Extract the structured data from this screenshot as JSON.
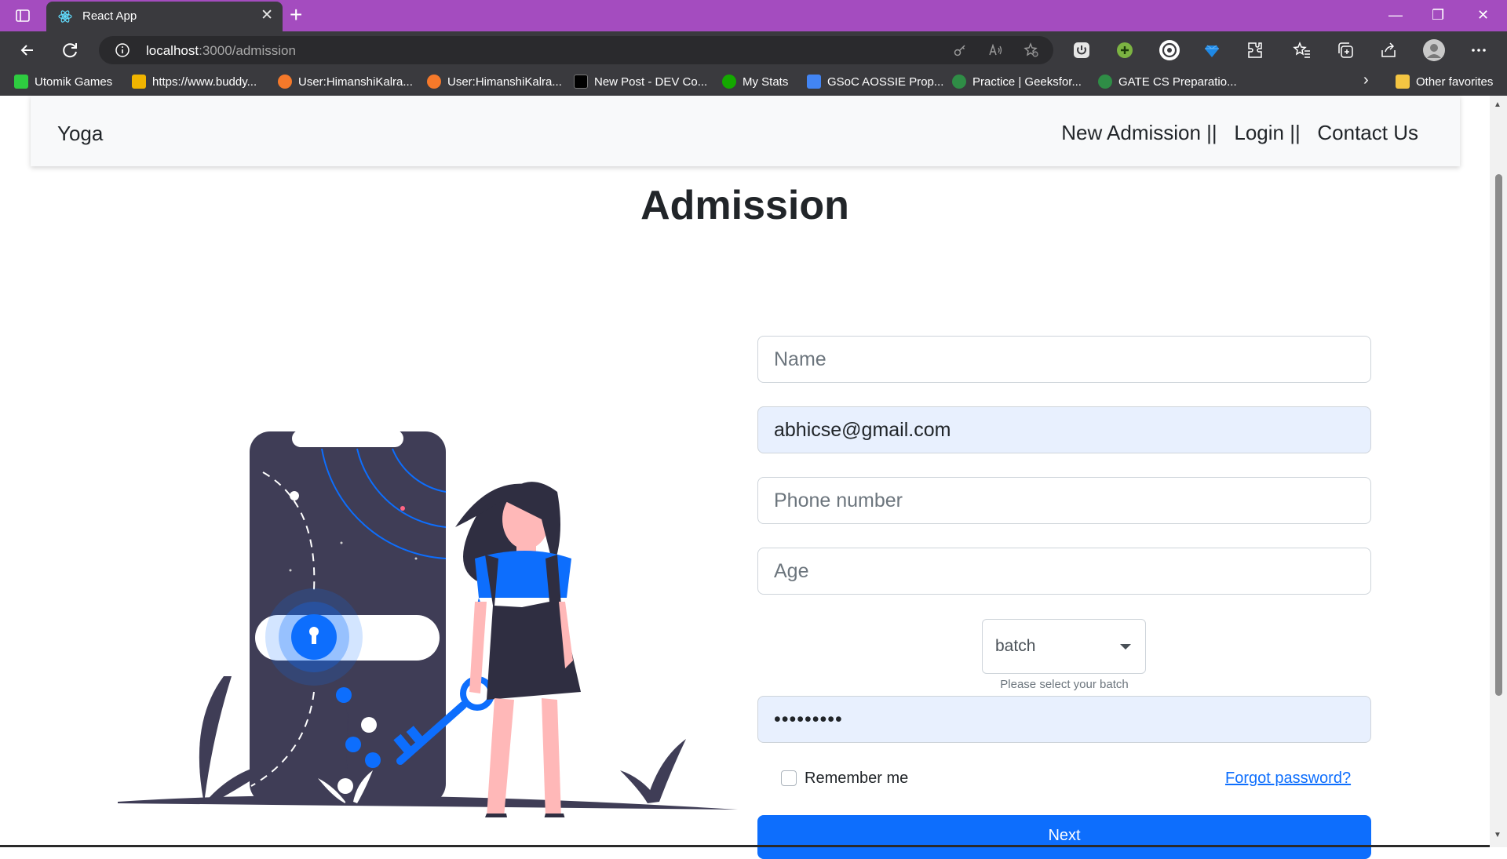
{
  "browser": {
    "tab_title": "React App",
    "tab_close": "✕",
    "new_tab": "+",
    "url_host": "localhost",
    "url_path": ":3000/admission",
    "window_controls": [
      "—",
      "❐",
      "✕"
    ],
    "bookmarks": [
      {
        "label": "Utomik Games",
        "icon": "utomik-icon",
        "color": "#2ecc40"
      },
      {
        "label": "https://www.buddy...",
        "icon": "buddy-icon",
        "color": "#f0b400"
      },
      {
        "label": "User:HimanshiKalra...",
        "icon": "blender-icon",
        "color": "#f5792a"
      },
      {
        "label": "User:HimanshiKalra...",
        "icon": "blender-icon",
        "color": "#f5792a"
      },
      {
        "label": "New Post - DEV Co...",
        "icon": "dev-icon",
        "color": "#000000"
      },
      {
        "label": "My Stats",
        "icon": "upwork-icon",
        "color": "#14a800"
      },
      {
        "label": "GSoC AOSSIE Prop...",
        "icon": "docs-icon",
        "color": "#4285f4"
      },
      {
        "label": "Practice | Geeksfor...",
        "icon": "gfg-icon",
        "color": "#2f8d46"
      },
      {
        "label": "GATE CS Preparatio...",
        "icon": "gfg-icon",
        "color": "#2f8d46"
      }
    ],
    "bookmarks_more": "›",
    "other_favorites": "Other favorites"
  },
  "navbar": {
    "brand": "Yoga",
    "links": [
      "New Admission ||",
      "Login ||",
      "Contact Us"
    ]
  },
  "page": {
    "heading": "Admission"
  },
  "form": {
    "name_placeholder": "Name",
    "email_value": "abhicse@gmail.com",
    "phone_placeholder": "Phone number",
    "age_placeholder": "Age",
    "batch_selected": "batch",
    "batch_helper": "Please select your batch",
    "password_value": "•••••••••",
    "remember_label": "Remember me",
    "forgot_link": "Forgot password?",
    "next_button": "Next"
  },
  "colors": {
    "titlebar": "#a44cbf",
    "chrome": "#3a3a3e",
    "primary": "#0d6efd",
    "autofill": "#e8f0fe"
  }
}
